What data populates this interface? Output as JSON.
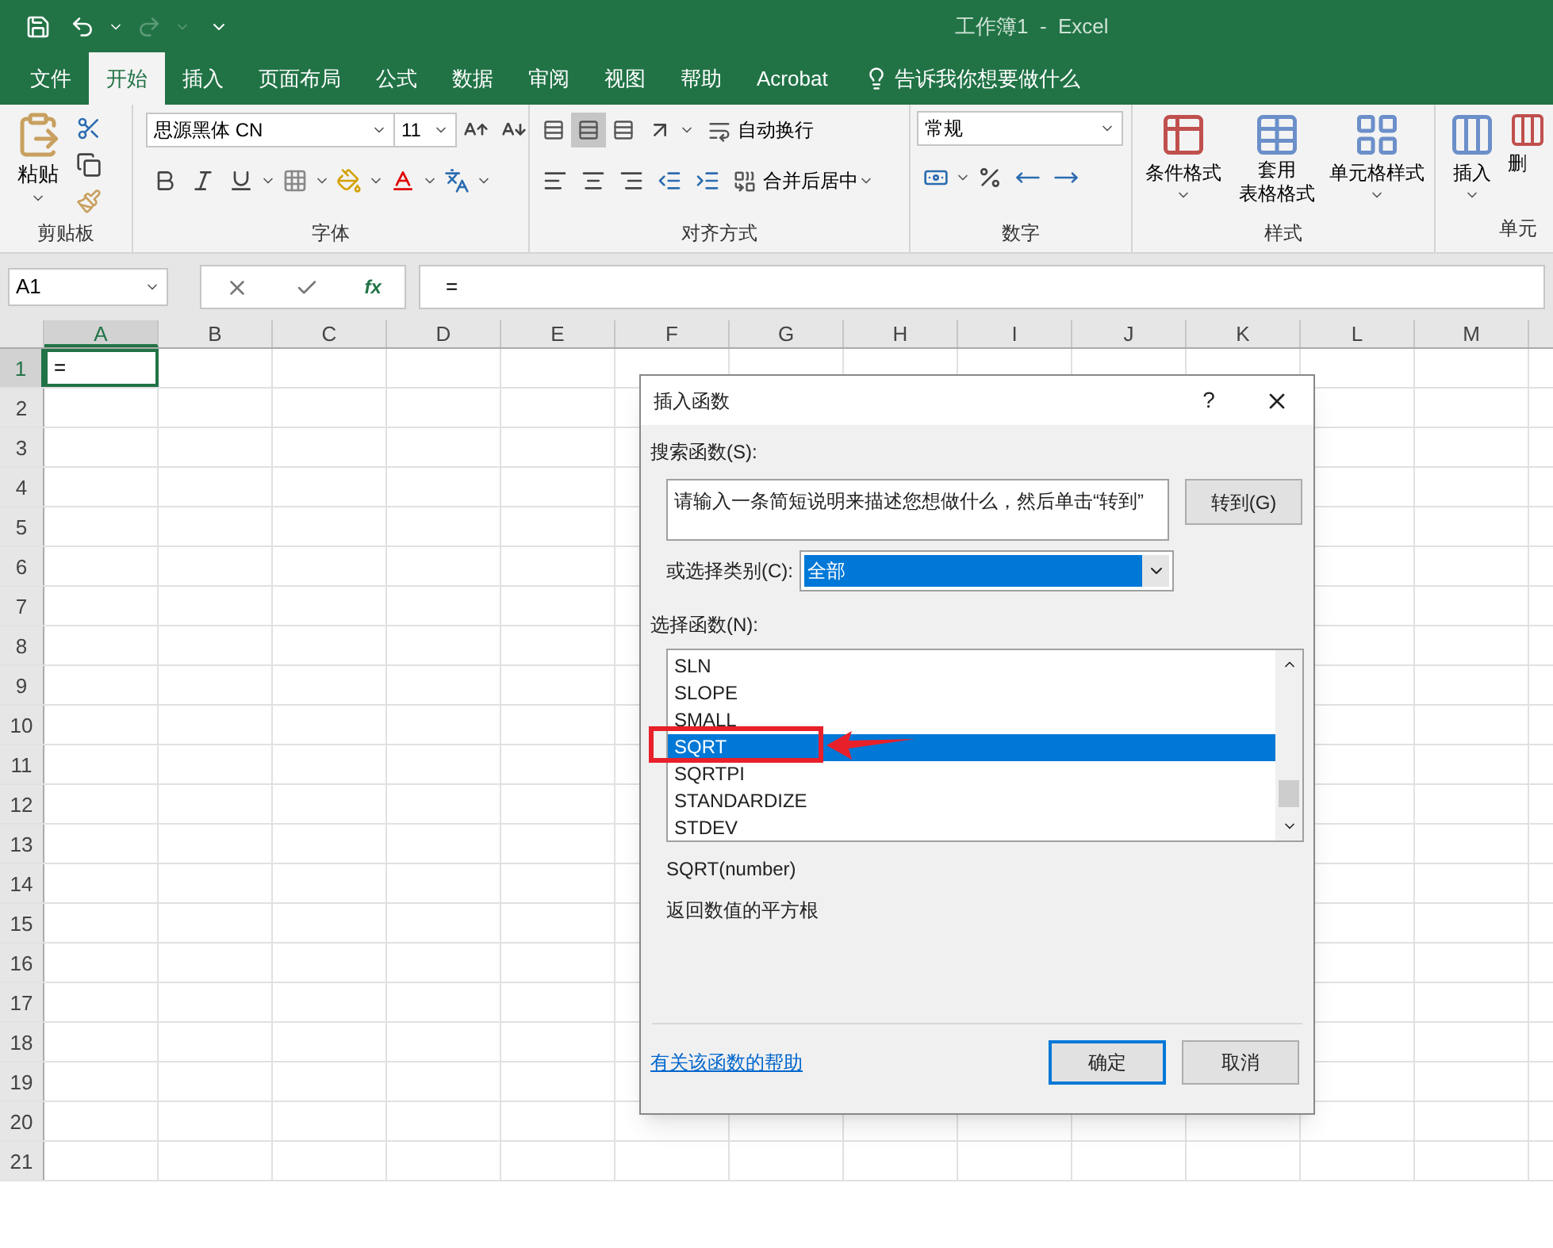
{
  "title_bar": {
    "title": "工作簿1  -  Excel"
  },
  "ribbon_tabs": [
    {
      "label": "文件",
      "selected": false
    },
    {
      "label": "开始",
      "selected": true
    },
    {
      "label": "插入",
      "selected": false
    },
    {
      "label": "页面布局",
      "selected": false
    },
    {
      "label": "公式",
      "selected": false
    },
    {
      "label": "数据",
      "selected": false
    },
    {
      "label": "审阅",
      "selected": false
    },
    {
      "label": "视图",
      "selected": false
    },
    {
      "label": "帮助",
      "selected": false
    },
    {
      "label": "Acrobat",
      "selected": false
    }
  ],
  "tell_me": {
    "label": "告诉我你想要做什么"
  },
  "clipboard": {
    "label": "剪贴板",
    "paste": "粘贴"
  },
  "font": {
    "label": "字体",
    "font_name": "思源黑体 CN",
    "font_size": "11"
  },
  "alignment": {
    "label": "对齐方式",
    "vertical_align": [
      {
        "selected": false
      },
      {
        "selected": true
      },
      {
        "selected": false
      }
    ],
    "wrap_text": "自动换行",
    "merge_center": "合并后居中"
  },
  "number": {
    "label": "数字",
    "format": "常规"
  },
  "styles": {
    "label": "样式",
    "conditional_format": "条件格式",
    "table_format": [
      "套用",
      "表格格式"
    ],
    "cell_styles": "单元格样式"
  },
  "cells": {
    "label": "单元",
    "insert": "插入",
    "delete": "删"
  },
  "formula_bar": {
    "name_box": "A1",
    "fx": "fx",
    "value": "="
  },
  "sheet": {
    "columns": [
      {
        "label": "A",
        "selected": true
      },
      {
        "label": "B",
        "selected": false
      },
      {
        "label": "C",
        "selected": false
      },
      {
        "label": "D",
        "selected": false
      },
      {
        "label": "E",
        "selected": false
      },
      {
        "label": "F",
        "selected": false
      },
      {
        "label": "G",
        "selected": false
      },
      {
        "label": "H",
        "selected": false
      },
      {
        "label": "I",
        "selected": false
      },
      {
        "label": "J",
        "selected": false
      },
      {
        "label": "K",
        "selected": false
      },
      {
        "label": "L",
        "selected": false
      },
      {
        "label": "M",
        "selected": false
      }
    ],
    "rows": [
      {
        "label": "1",
        "selected": true
      },
      {
        "label": "2",
        "selected": false
      },
      {
        "label": "3",
        "selected": false
      },
      {
        "label": "4",
        "selected": false
      },
      {
        "label": "5",
        "selected": false
      },
      {
        "label": "6",
        "selected": false
      },
      {
        "label": "7",
        "selected": false
      },
      {
        "label": "8",
        "selected": false
      },
      {
        "label": "9",
        "selected": false
      },
      {
        "label": "10",
        "selected": false
      },
      {
        "label": "11",
        "selected": false
      },
      {
        "label": "12",
        "selected": false
      },
      {
        "label": "13",
        "selected": false
      },
      {
        "label": "14",
        "selected": false
      },
      {
        "label": "15",
        "selected": false
      },
      {
        "label": "16",
        "selected": false
      },
      {
        "label": "17",
        "selected": false
      },
      {
        "label": "18",
        "selected": false
      },
      {
        "label": "19",
        "selected": false
      },
      {
        "label": "20",
        "selected": false
      },
      {
        "label": "21",
        "selected": false
      }
    ],
    "active_cell": {
      "value": "="
    }
  },
  "dialog": {
    "title": "插入函数",
    "help": "?",
    "search_label": "搜索函数(S):",
    "search_value": "请输入一条简短说明来描述您想做什么，然后单击“转到”",
    "go_button": "转到(G)",
    "category_label": "或选择类别(C):",
    "category_value": "全部",
    "list_label": "选择函数(N):",
    "functions": [
      {
        "name": "SLN",
        "selected": false
      },
      {
        "name": "SLOPE",
        "selected": false
      },
      {
        "name": "SMALL",
        "selected": false
      },
      {
        "name": "SQRT",
        "selected": true
      },
      {
        "name": "SQRTPI",
        "selected": false
      },
      {
        "name": "STANDARDIZE",
        "selected": false
      },
      {
        "name": "STDEV",
        "selected": false
      }
    ],
    "signature": "SQRT(number)",
    "description": "返回数值的平方根",
    "help_link": "有关该函数的帮助",
    "ok_button": "确定",
    "cancel_button": "取消"
  }
}
